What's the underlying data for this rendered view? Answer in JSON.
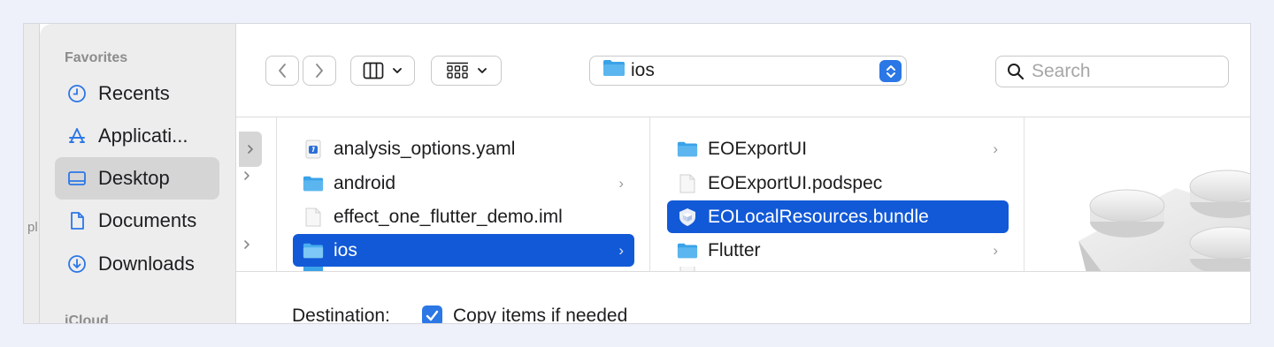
{
  "under_window": {
    "text": "pl"
  },
  "sidebar": {
    "sections": [
      {
        "label": "Favorites"
      },
      {
        "label": "iCloud"
      }
    ],
    "items": [
      {
        "label": "Recents",
        "icon": "clock-icon"
      },
      {
        "label": "Applicati...",
        "icon": "applications-icon"
      },
      {
        "label": "Desktop",
        "icon": "desktop-icon",
        "selected": true
      },
      {
        "label": "Documents",
        "icon": "document-icon"
      },
      {
        "label": "Downloads",
        "icon": "download-icon"
      }
    ]
  },
  "toolbar": {
    "back_icon": "chevron-left-icon",
    "forward_icon": "chevron-right-icon",
    "view_icon": "columns-view-icon",
    "group_icon": "grid-group-icon",
    "path": {
      "label": "ios"
    },
    "search": {
      "placeholder": "Search",
      "value": ""
    }
  },
  "columns": [
    {
      "items": [
        {
          "label": "analysis_options.yaml",
          "icon": "yaml-file-icon",
          "folder": false
        },
        {
          "label": "android",
          "icon": "folder-icon",
          "folder": true
        },
        {
          "label": "effect_one_flutter_demo.iml",
          "icon": "file-icon",
          "folder": false
        },
        {
          "label": "ios",
          "icon": "folder-icon",
          "folder": true,
          "selected": true
        }
      ]
    },
    {
      "items": [
        {
          "label": "EOExportUI",
          "icon": "folder-icon",
          "folder": true
        },
        {
          "label": "EOExportUI.podspec",
          "icon": "file-icon",
          "folder": false
        },
        {
          "label": "EOLocalResources.bundle",
          "icon": "bundle-icon",
          "folder": false,
          "selected": true
        },
        {
          "label": "Flutter",
          "icon": "folder-icon",
          "folder": true
        }
      ]
    }
  ],
  "bottom": {
    "destination_label": "Destination:",
    "copy_checkbox_label": "Copy items if needed",
    "copy_checked": true
  },
  "colors": {
    "accent": "#2b77e6",
    "selection": "#1259d7",
    "folder": "#3aa2e8"
  }
}
